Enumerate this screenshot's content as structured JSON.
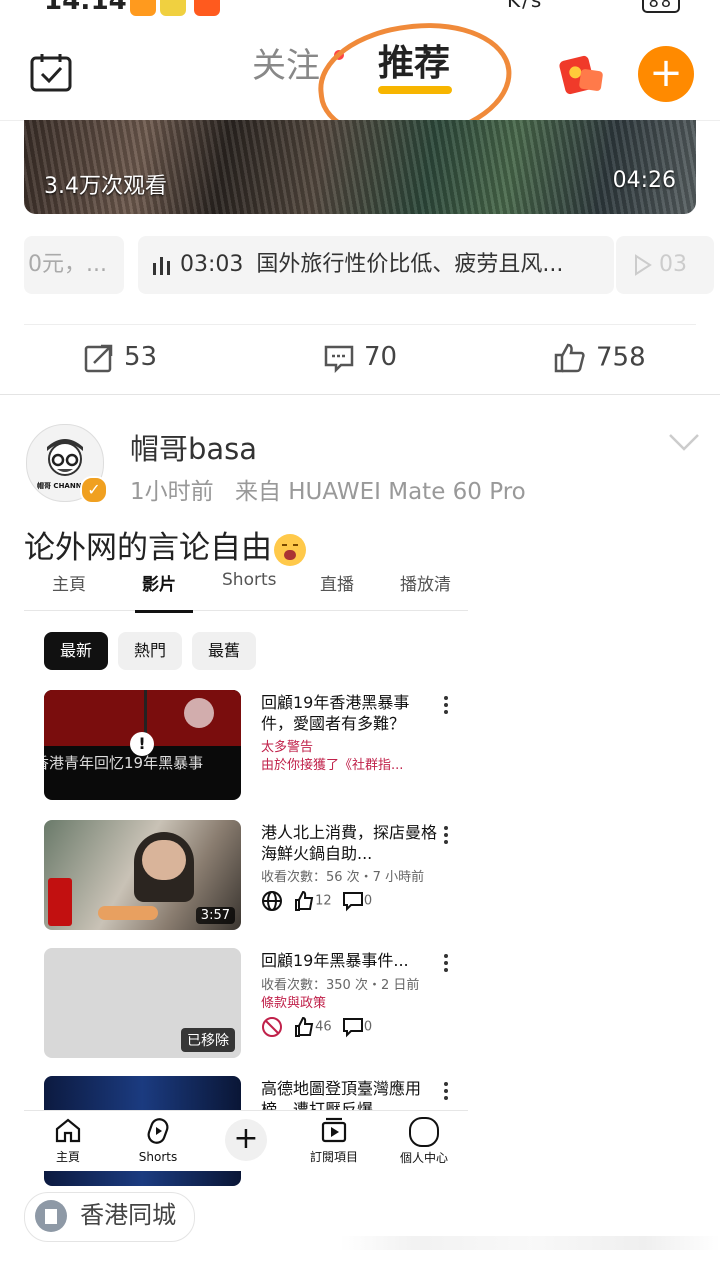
{
  "status_bar": {
    "time": "14:14",
    "net_speed": "K/s",
    "battery": "88"
  },
  "top_nav": {
    "tab_follow": "关注",
    "tab_recommend": "推荐"
  },
  "video_card": {
    "views": "3.4万次观看",
    "duration": "04:26"
  },
  "related": {
    "left_chip": "0元，...",
    "mid_chip_time": "03:03",
    "mid_chip_title": "国外旅行性价比低、疲劳且风...",
    "right_chip": "03"
  },
  "actions": {
    "share_count": "53",
    "comment_count": "70",
    "like_count": "758"
  },
  "post": {
    "author": "帽哥basa",
    "time": "1小时前",
    "source": "来自 HUAWEI Mate 60 Pro",
    "text": "论外网的言论自由",
    "avatar_text": "帽哥 CHANN"
  },
  "embedded": {
    "tabs": [
      "主頁",
      "影片",
      "Shorts",
      "直播",
      "播放清"
    ],
    "filters": [
      "最新",
      "熱門",
      "最舊"
    ],
    "videos": [
      {
        "title": "回顧19年香港黑暴事件，愛國者有多難？",
        "warn1": "太多警告",
        "warn2": "由於你接獲了《社群指...",
        "thumb_text": "香港青年回忆19年黑暴事"
      },
      {
        "title": "港人北上消費，探店曼格海鮮火鍋自助...",
        "sub": "收看次數：56 次・7 小時前",
        "likes": "12",
        "comments": "0",
        "duration": "3:57"
      },
      {
        "title": "回顧19年黑暴事件...",
        "sub": "收看次數：350 次・2 日前",
        "warn": "條款與政策",
        "likes": "46",
        "comments": "0",
        "badge": "已移除"
      },
      {
        "title": "高德地圖登頂臺灣應用榜，遭打壓反爆"
      }
    ],
    "bottom_nav": [
      "主頁",
      "Shorts",
      "訂閱項目",
      "個人中心"
    ]
  },
  "location": {
    "label": "香港同城"
  },
  "colors": {
    "accent_orange": "#ff8a00",
    "underline_yellow": "#f7b500",
    "annotation": "#f08a3a",
    "warning_red": "#c0214a"
  }
}
